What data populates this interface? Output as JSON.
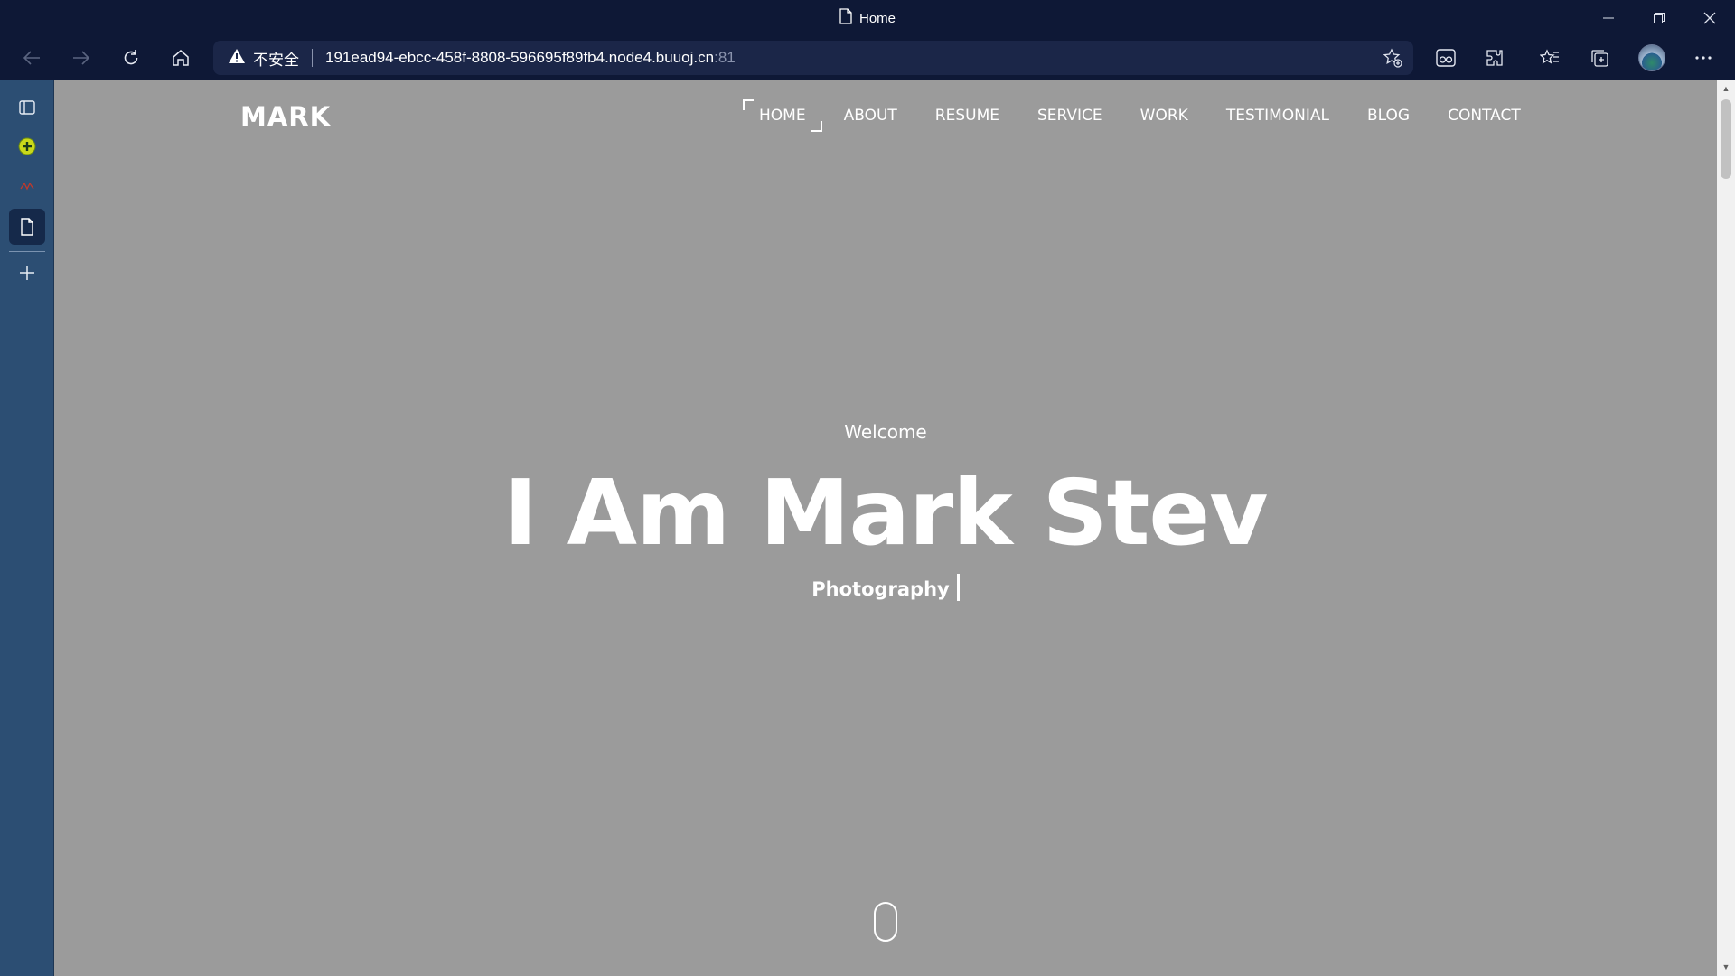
{
  "window": {
    "tab_title": "Home"
  },
  "toolbar": {
    "security_label": "不安全",
    "url_host": "191ead94-ebcc-458f-8808-596695f89fb4.node4.buuoj.cn",
    "url_port": ":81"
  },
  "site": {
    "logo": "MARK",
    "nav": [
      "HOME",
      "ABOUT",
      "RESUME",
      "SERVICE",
      "WORK",
      "TESTIMONIAL",
      "BLOG",
      "CONTACT"
    ],
    "active_nav": "HOME"
  },
  "hero": {
    "welcome": "Welcome",
    "headline": "I Am Mark Stev",
    "subtitle": "Photography"
  },
  "colors": {
    "browser_chrome": "#0e1836",
    "sidebar": "#2c4e73",
    "page_background": "#9b9b9b",
    "text": "#ffffff"
  },
  "icons": [
    "page-icon",
    "minimize-icon",
    "restore-icon",
    "close-icon",
    "back-icon",
    "forward-icon",
    "refresh-icon",
    "home-icon",
    "warning-icon",
    "favorite-add-icon",
    "reading-view-icon",
    "extensions-icon",
    "favorites-icon",
    "collections-icon",
    "profile-avatar",
    "more-icon",
    "tab-actions-icon",
    "add-tab-icon",
    "scroll-mouse-icon"
  ]
}
